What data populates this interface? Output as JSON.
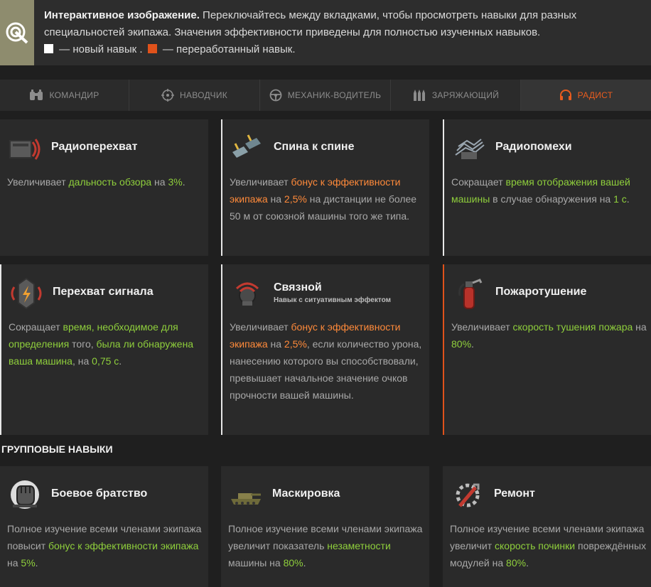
{
  "banner": {
    "icon": "interactive-target-icon",
    "title": "Интерактивное изображение.",
    "text": " Переключайтесь между вкладками, чтобы просмотреть навыки для разных специальностей экипажа. Значения эффективности приведены для полностью изученных навыков.",
    "legend_new": " — новый навык .",
    "legend_reworked": " — переработанный навык."
  },
  "tabs": [
    {
      "label": "КОМАНДИР",
      "icon": "binoculars-icon",
      "active": false
    },
    {
      "label": "НАВОДЧИК",
      "icon": "crosshair-icon",
      "active": false
    },
    {
      "label": "МЕХАНИК-ВОДИТЕЛЬ",
      "icon": "steering-wheel-icon",
      "active": false
    },
    {
      "label": "ЗАРЯЖАЮЩИЙ",
      "icon": "shells-icon",
      "active": false
    },
    {
      "label": "РАДИСТ",
      "icon": "headphones-icon",
      "active": true
    }
  ],
  "skills": {
    "s1": {
      "title": "Радиоперехват",
      "d": [
        "Увеличивает ",
        "дальность обзора",
        " на ",
        "3%",
        "."
      ]
    },
    "s2": {
      "title": "Спина к спине",
      "d": [
        "Увеличивает ",
        "бонус к эффективности экипажа",
        " на ",
        "2,5%",
        " на дистанции не более 50 м от союзной машины того же типа."
      ]
    },
    "s3": {
      "title": "Радиопомехи",
      "d": [
        "Сокращает ",
        "время отображения вашей машины",
        " в случае обнаружения на ",
        "1 с",
        "."
      ]
    },
    "s4": {
      "title": "Перехват сигнала",
      "d": [
        "Сокращает ",
        "время, необходимое для определения",
        " того, ",
        "была ли обнаружена ваша машина",
        ", на ",
        "0,75 с",
        "."
      ]
    },
    "s5": {
      "title": "Связной",
      "subtitle": "Навык с ситуативным эффектом",
      "d": [
        "Увеличивает ",
        "бонус к эффективности экипажа",
        " на ",
        "2,5%",
        ", если количество урона, нанесению которого вы способствовали, превышает начальное значение очков прочности вашей машины."
      ]
    },
    "s6": {
      "title": "Пожаротушение",
      "d": [
        "Увеличивает ",
        "скорость тушения пожара",
        " на ",
        "80%",
        "."
      ]
    }
  },
  "group_section": {
    "title": "ГРУППОВЫЕ НАВЫКИ"
  },
  "group": {
    "g1": {
      "title": "Боевое братство",
      "d": [
        "Полное изучение всеми членами экипажа повысит ",
        "бонус к эффективности экипажа",
        " на ",
        "5%",
        "."
      ]
    },
    "g2": {
      "title": "Маскировка",
      "d": [
        "Полное изучение всеми членами экипажа увеличит показатель ",
        "незаметности",
        " машины на ",
        "80%",
        "."
      ]
    },
    "g3": {
      "title": "Ремонт",
      "d": [
        "Полное изучение всеми членами экипажа увеличит ",
        "скорость починки",
        " повреждённых модулей на ",
        "80%",
        "."
      ]
    }
  },
  "colors": {
    "accent": "#e0521b",
    "highlight_green": "#8fcf3c",
    "highlight_orange": "#ff8a3a",
    "new_marker": "#ffffff"
  }
}
